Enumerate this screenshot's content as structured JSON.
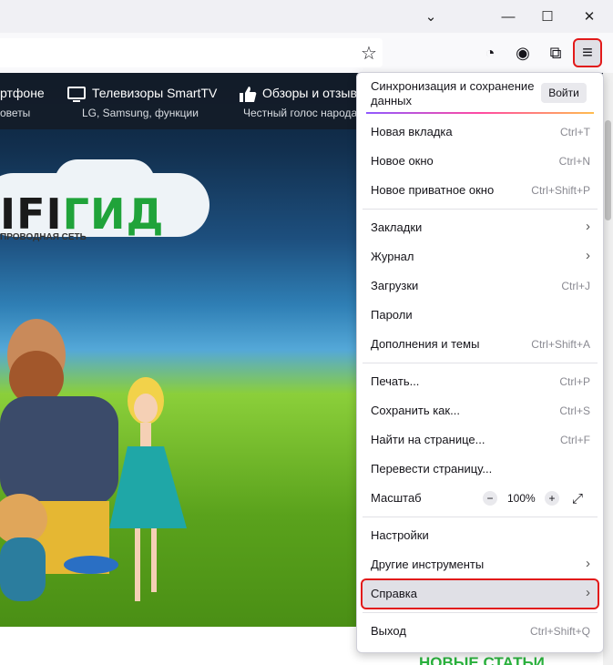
{
  "titlebar": {
    "tabs_dropdown_icon": "chevron-down-icon",
    "minimize_icon": "minimize-icon",
    "maximize_icon": "maximize-icon",
    "close_icon": "close-icon",
    "glyphs": {
      "chevron": "⌄",
      "minimize": "—",
      "maximize": "☐",
      "close": "✕"
    }
  },
  "toolbar": {
    "bookmark_glyph": "☆",
    "pocket_glyph": "◔",
    "account_glyph": "◉",
    "extensions_glyph": "⧉",
    "menu_glyph": "≡"
  },
  "site": {
    "nav": [
      {
        "title": "ртфоне",
        "subtitle": "оветы",
        "icon": "smartphone-icon"
      },
      {
        "title": "Телевизоры SmartTV",
        "subtitle": "LG, Samsung, функции",
        "icon": "tv-icon"
      },
      {
        "title": "Обзоры и отзыв",
        "subtitle": "Честный голос народа",
        "icon": "thumbs-up-icon"
      }
    ],
    "logo_black": "IFI",
    "logo_green": "ГИД",
    "logo_sub": "ПРОВОДНАЯ СЕТЬ",
    "new_articles": "НОВЫЕ СТАТЬИ"
  },
  "menu": {
    "sync_label": "Синхронизация и сохранение данных",
    "sync_button": "Войти",
    "items": [
      {
        "label": "Новая вкладка",
        "shortcut": "Ctrl+T"
      },
      {
        "label": "Новое окно",
        "shortcut": "Ctrl+N"
      },
      {
        "label": "Новое приватное окно",
        "shortcut": "Ctrl+Shift+P"
      },
      {
        "label": "Закладки",
        "shortcut": ""
      },
      {
        "label": "Журнал",
        "shortcut": ""
      },
      {
        "label": "Загрузки",
        "shortcut": "Ctrl+J"
      },
      {
        "label": "Пароли",
        "shortcut": ""
      },
      {
        "label": "Дополнения и темы",
        "shortcut": "Ctrl+Shift+A"
      },
      {
        "label": "Печать...",
        "shortcut": "Ctrl+P"
      },
      {
        "label": "Сохранить как...",
        "shortcut": "Ctrl+S"
      },
      {
        "label": "Найти на странице...",
        "shortcut": "Ctrl+F"
      },
      {
        "label": "Перевести страницу...",
        "shortcut": ""
      },
      {
        "label": "Масштаб",
        "shortcut": ""
      },
      {
        "label": "Настройки",
        "shortcut": ""
      },
      {
        "label": "Другие инструменты",
        "shortcut": ""
      },
      {
        "label": "Справка",
        "shortcut": ""
      },
      {
        "label": "Выход",
        "shortcut": "Ctrl+Shift+Q"
      }
    ],
    "zoom": {
      "minus": "−",
      "value": "100%",
      "plus": "+",
      "fullscreen": "⤢"
    },
    "submenu_chevron": "›"
  },
  "colors": {
    "highlight_border": "#e21a1a",
    "logo_green": "#20a33a",
    "new_articles_green": "#2bb33e"
  }
}
